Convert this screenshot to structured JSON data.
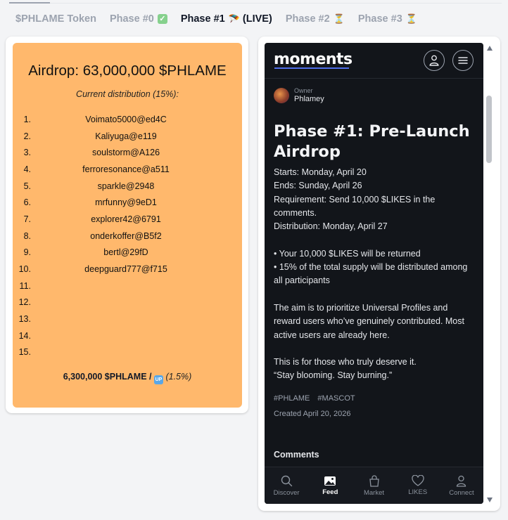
{
  "tabs": [
    {
      "label": "$PHLAME Token",
      "status": ""
    },
    {
      "label": "Phase #0",
      "status": "✓"
    },
    {
      "label": "Phase #1",
      "status": "🪂",
      "suffix": "(LIVE)"
    },
    {
      "label": "Phase #2",
      "status": "⏳"
    },
    {
      "label": "Phase #3",
      "status": "⏳"
    }
  ],
  "airdrop": {
    "title": "Airdrop: 63,000,000 $PHLAME",
    "subtitle": "Current distribution (15%):",
    "rows": [
      {
        "num": "1.",
        "name": "Voimato5000@ed4C"
      },
      {
        "num": "2.",
        "name": "Kaliyuga@e119"
      },
      {
        "num": "3.",
        "name": "soulstorm@A126"
      },
      {
        "num": "4.",
        "name": "ferroresonance@a511"
      },
      {
        "num": "5.",
        "name": "sparkle@2948"
      },
      {
        "num": "6.",
        "name": "mrfunny@9eD1"
      },
      {
        "num": "7.",
        "name": "explorer42@6791"
      },
      {
        "num": "8.",
        "name": "onderkoffer@B5f2"
      },
      {
        "num": "9.",
        "name": "bertl@29fD"
      },
      {
        "num": "10.",
        "name": "deepguard777@f715"
      },
      {
        "num": "11.",
        "name": ""
      },
      {
        "num": "12.",
        "name": ""
      },
      {
        "num": "13.",
        "name": ""
      },
      {
        "num": "14.",
        "name": ""
      },
      {
        "num": "15.",
        "name": ""
      }
    ],
    "footer_amount": "6,300,000 $PHLAME /",
    "footer_icon": "UP",
    "footer_pct": "(1.5%)"
  },
  "post": {
    "logo": "moments",
    "owner_label": "Owner",
    "owner_name": "Phlamey",
    "title": "Phase #1: Pre-Launch Airdrop",
    "lines": {
      "starts": "Starts: Monday, April 20",
      "ends": "Ends: Sunday, April 26",
      "requirement": "Requirement: Send 10,000 $LIKES in the comments.",
      "distribution": "Distribution: Monday, April 27",
      "bullet1": "• Your 10,000 $LIKES will be returned",
      "bullet2": "• 15% of the total supply will be distributed among all participants",
      "aim": "The aim is to prioritize Universal Profiles and reward users who’ve genuinely contributed. Most active users are already here.",
      "deserve": "This is for those who truly deserve it.",
      "quote": "“Stay blooming. Stay burning.”"
    },
    "tags": [
      "#PHLAME",
      "#MASCOT"
    ],
    "created": "Created April 20, 2026",
    "comments_label": "Comments"
  },
  "nav": {
    "discover": "Discover",
    "feed": "Feed",
    "market": "Market",
    "likes": "LIKES",
    "connect": "Connect"
  }
}
